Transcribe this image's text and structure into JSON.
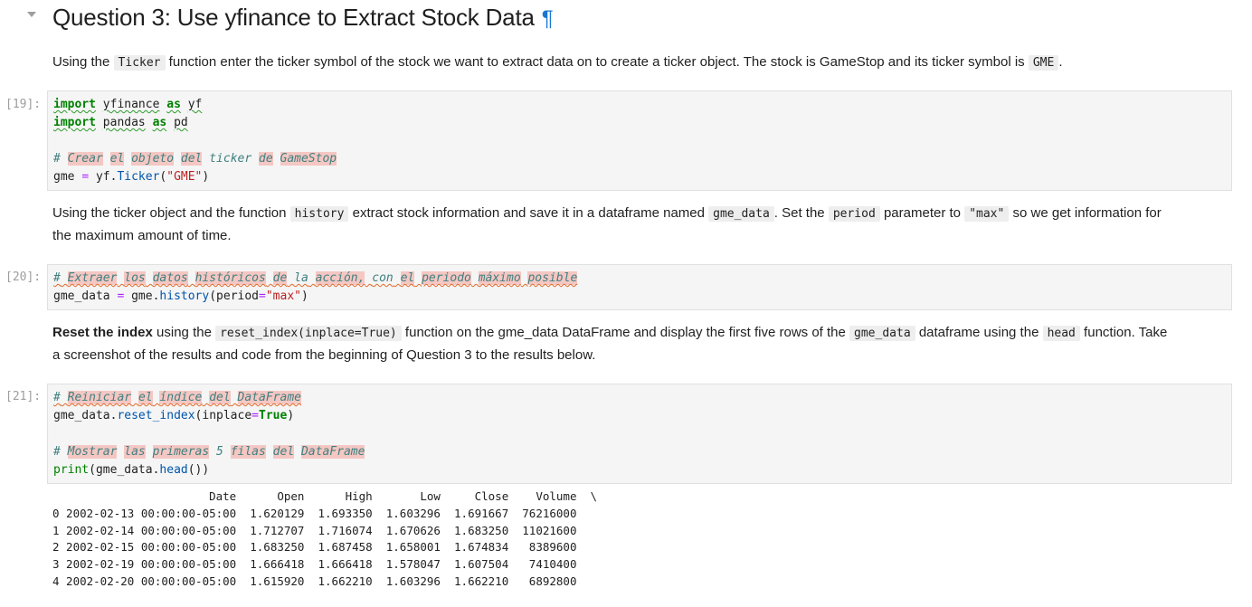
{
  "heading": {
    "title": "Question 3: Use yfinance to Extract Stock Data",
    "anchor": "¶"
  },
  "md1": {
    "t1": "Using the ",
    "code1": "Ticker",
    "t2": " function enter the ticker symbol of the stock we want to extract data on to create a ticker object. The stock is GameStop and its ticker symbol is ",
    "code2": "GME",
    "t3": "."
  },
  "cell19": {
    "prompt": "[19]:",
    "line1": {
      "kw1": "import",
      "mod": "yfinance",
      "kw2": "as",
      "alias": "yf"
    },
    "line2": {
      "kw1": "import",
      "mod": "pandas",
      "kw2": "as",
      "alias": "pd"
    },
    "line4": {
      "hash": "#",
      "w1": "Crear",
      "w2": "el",
      "w3": "objeto",
      "w4": "del",
      "w5": "ticker",
      "w6": "de",
      "w7": "GameStop"
    },
    "line5": {
      "var": "gme",
      "eq": "=",
      "obj": "yf",
      "attr": "Ticker",
      "str": "\"GME\""
    }
  },
  "md2": {
    "t1": "Using the ticker object and the function ",
    "code1": "history",
    "t2": " extract stock information and save it in a dataframe named ",
    "code2": "gme_data",
    "t3": ". Set the ",
    "code3": "period",
    "t4": " parameter to ",
    "code4": "\"max\"",
    "t5": " so we get information for",
    "t6": "the maximum amount of time."
  },
  "cell20": {
    "prompt": "[20]:",
    "line1": {
      "hash": "#",
      "w1": "Extraer",
      "w2": "los",
      "w3": "datos",
      "w4": "históricos",
      "w5": "de",
      "w6": "la",
      "w7": "acción,",
      "w8": "con",
      "w9": "el",
      "w10": "periodo",
      "w11": "máximo",
      "w12": "posible"
    },
    "line2": {
      "var": "gme_data",
      "eq": "=",
      "obj": "gme",
      "attr": "history",
      "param": "period",
      "str": "\"max\""
    }
  },
  "md3": {
    "bold": "Reset the index",
    "t1": " using the ",
    "code1": "reset_index(inplace=True)",
    "t2": " function on the gme_data DataFrame and display the first five rows of the ",
    "code2": "gme_data",
    "t3": " dataframe using the ",
    "code3": "head",
    "t4": " function. Take",
    "t5": "a screenshot of the results and code from the beginning of Question 3 to the results below."
  },
  "cell21": {
    "prompt": "[21]:",
    "line1": {
      "hash": "#",
      "w1": "Reiniciar",
      "w2": "el",
      "w3": "índice",
      "w4": "del",
      "w5": "DataFrame"
    },
    "line2": {
      "var": "gme_data",
      "attr": "reset_index",
      "param": "inplace",
      "val": "True"
    },
    "line4": {
      "hash": "#",
      "w1": "Mostrar",
      "w2": "las",
      "w3": "primeras",
      "w4": "5",
      "w5": "filas",
      "w6": "del",
      "w7": "DataFrame"
    },
    "line5": {
      "fn": "print",
      "var": "gme_data",
      "attr": "head"
    }
  },
  "output": {
    "header": "                       Date      Open      High       Low     Close    Volume  \\",
    "rows": [
      "0 2002-02-13 00:00:00-05:00  1.620129  1.693350  1.603296  1.691667  76216000",
      "1 2002-02-14 00:00:00-05:00  1.712707  1.716074  1.670626  1.683250  11021600",
      "2 2002-02-15 00:00:00-05:00  1.683250  1.687458  1.658001  1.674834   8389600",
      "3 2002-02-19 00:00:00-05:00  1.666418  1.666418  1.578047  1.607504   7410400",
      "4 2002-02-20 00:00:00-05:00  1.615920  1.662210  1.603296  1.662210   6892800"
    ]
  }
}
